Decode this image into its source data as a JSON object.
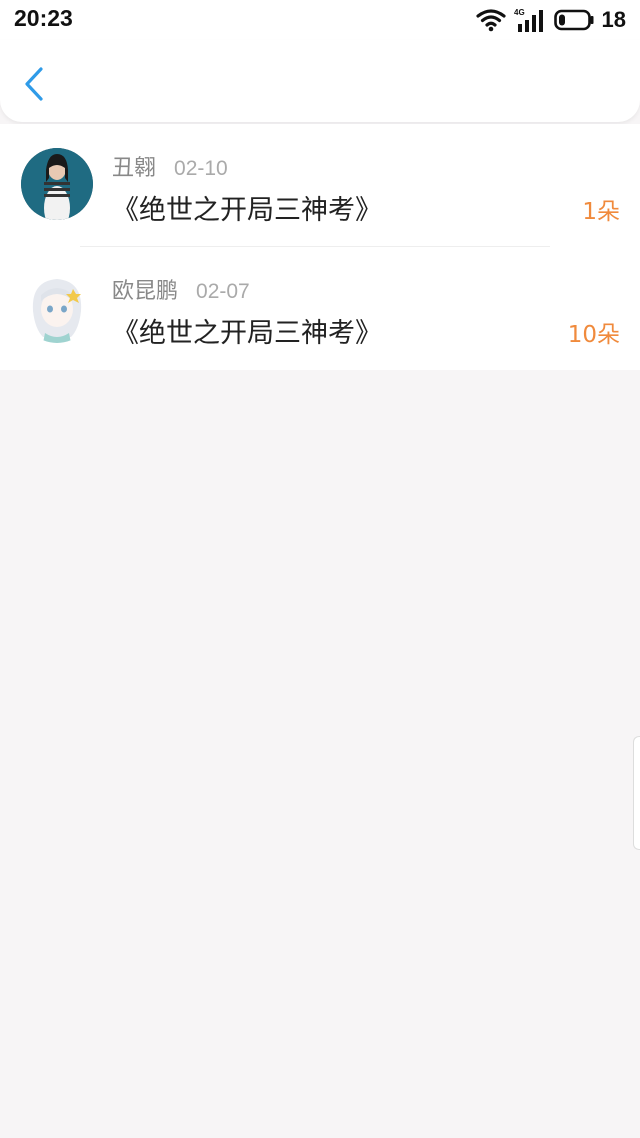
{
  "status_bar": {
    "time": "20:23",
    "network": "4G",
    "battery_level": "18",
    "icons": [
      "wifi-icon",
      "cellular-signal-icon",
      "battery-icon"
    ]
  },
  "header": {
    "back_icon": "chevron-left-icon",
    "accent_color": "#2f9be8"
  },
  "records": [
    {
      "name": "丑翱",
      "date": "02-10",
      "book": "《绝世之开局三神考》",
      "amount": "1朵"
    },
    {
      "name": "欧昆鹏",
      "date": "02-07",
      "book": "《绝世之开局三神考》",
      "amount": "10朵"
    }
  ],
  "colors": {
    "amount": "#f08a3c",
    "background": "#f7f5f6"
  }
}
